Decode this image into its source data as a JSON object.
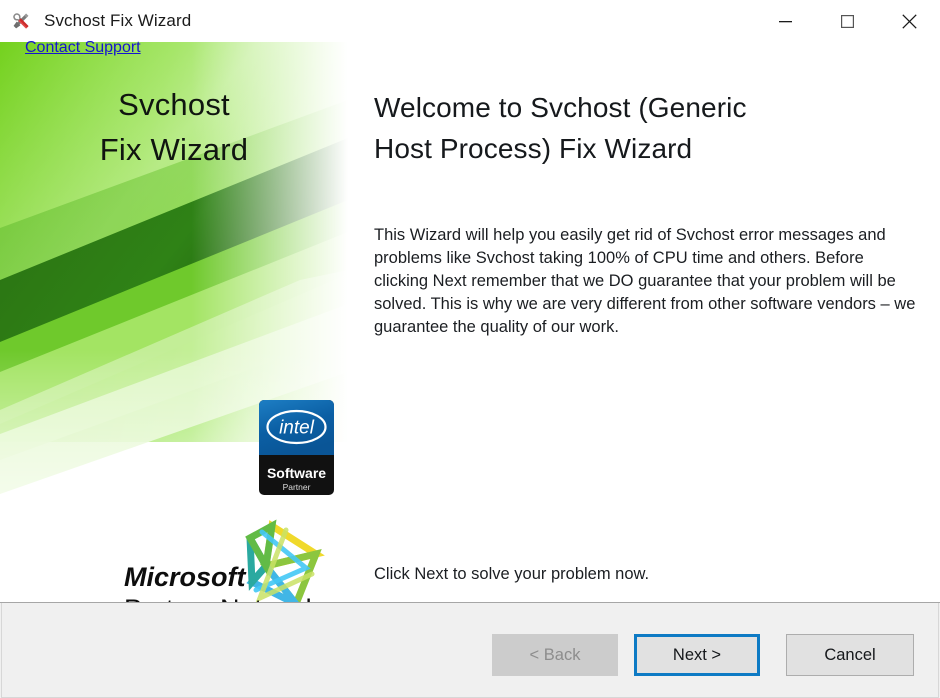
{
  "titlebar": {
    "icon": "wrench-screwdriver-icon",
    "title": "Svchost Fix Wizard",
    "controls": [
      {
        "name": "minimize-button",
        "glyph": "minimize-icon"
      },
      {
        "name": "maximize-button",
        "glyph": "maximize-icon"
      },
      {
        "name": "close-button",
        "glyph": "close-icon"
      }
    ]
  },
  "sidebar": {
    "banner_line1": "Svchost",
    "banner_line2": "Fix Wizard",
    "colors": {
      "green_bright": "#7ed321",
      "green_light": "#a8e85c",
      "green_dark": "#2d7a14",
      "green_mid": "#5cb328"
    },
    "intel_badge": {
      "name": "intel-software-partner-badge",
      "brand": "intel",
      "line1": "Software",
      "line2": "Partner"
    },
    "mpn_logo": {
      "name": "microsoft-partner-network-logo",
      "line1": "Microsoft",
      "line2": "Partner Network"
    }
  },
  "content": {
    "heading_line1": "Welcome to Svchost (Generic",
    "heading_line2": "Host Process) Fix Wizard",
    "body": "This Wizard will help you easily get rid of Svchost error messages and problems like Svchost taking 100% of CPU time and others. Before clicking Next remember that we DO guarantee that your problem will be solved. This is why we are very different from other software vendors – we guarantee the quality of our work.",
    "cta": "Click Next to solve your problem now."
  },
  "footer": {
    "contact_support": "Contact Support",
    "back_label": "< Back",
    "next_label": "Next >",
    "cancel_label": "Cancel",
    "focus_color": "#0d7ac4"
  }
}
